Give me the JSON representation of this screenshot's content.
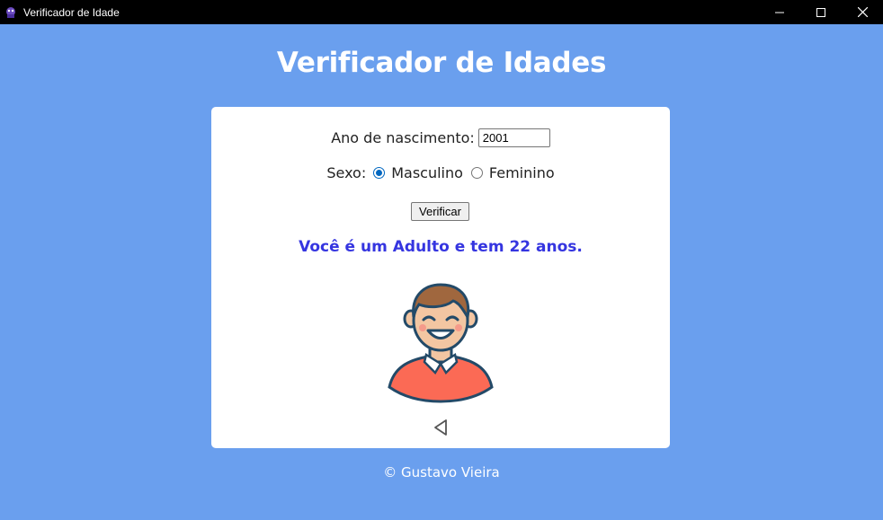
{
  "window": {
    "title": "Verificador de Idade",
    "icon": "app-icon"
  },
  "page": {
    "heading": "Verificador de Idades",
    "footer": "© Gustavo Vieira",
    "background_color": "#6a9fee"
  },
  "form": {
    "year_label": "Ano de nascimento:",
    "year_value": "2001",
    "sex_label": "Sexo:",
    "sex_options": [
      {
        "label": "Masculino",
        "checked": true
      },
      {
        "label": "Feminino",
        "checked": false
      }
    ],
    "verify_label": "Verificar"
  },
  "result": {
    "text": "Você é um Adulto e tem 22 anos.",
    "color": "#3535e0",
    "image": "adult-man-avatar"
  },
  "icons": {
    "back": "triangle-left-icon"
  }
}
